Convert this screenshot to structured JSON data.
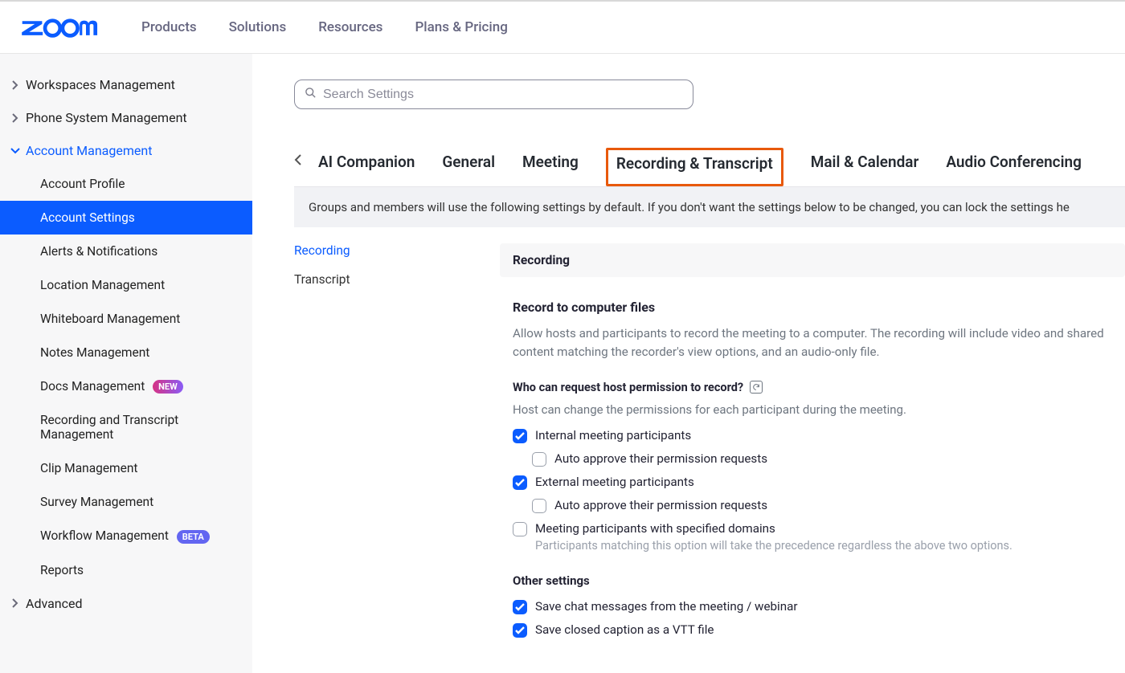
{
  "topnav": [
    "Products",
    "Solutions",
    "Resources",
    "Plans & Pricing"
  ],
  "search": {
    "placeholder": "Search Settings"
  },
  "sidebar": {
    "groups": [
      {
        "label": "Workspaces Management",
        "expanded": false
      },
      {
        "label": "Phone System Management",
        "expanded": false
      },
      {
        "label": "Account Management",
        "expanded": true
      },
      {
        "label": "Advanced",
        "expanded": false
      }
    ],
    "account_children": [
      {
        "label": "Account Profile"
      },
      {
        "label": "Account Settings",
        "active": true
      },
      {
        "label": "Alerts & Notifications"
      },
      {
        "label": "Location Management"
      },
      {
        "label": "Whiteboard Management"
      },
      {
        "label": "Notes Management"
      },
      {
        "label": "Docs Management",
        "badge": "NEW",
        "badgeClass": "new"
      },
      {
        "label": "Recording and Transcript Management"
      },
      {
        "label": "Clip Management"
      },
      {
        "label": "Survey Management"
      },
      {
        "label": "Workflow Management",
        "badge": "BETA",
        "badgeClass": "beta"
      },
      {
        "label": "Reports"
      }
    ]
  },
  "tabs": [
    "AI Companion",
    "General",
    "Meeting",
    "Recording & Transcript",
    "Mail & Calendar",
    "Audio Conferencing"
  ],
  "tabs_highlight_index": 3,
  "banner": "Groups and members will use the following settings by default. If you don't want the settings below to be changed, you can lock the settings he",
  "subnav": [
    {
      "label": "Recording",
      "active": true
    },
    {
      "label": "Transcript"
    }
  ],
  "section": {
    "header": "Recording",
    "title": "Record to computer files",
    "desc": "Allow hosts and participants to record the meeting to a computer. The recording will include video and shared content matching the recorder's view options, and an audio-only file.",
    "sub_q": "Who can request host permission to record?",
    "sub_desc": "Host can change the permissions for each participant during the meeting.",
    "opts": [
      {
        "label": "Internal meeting participants",
        "checked": true
      },
      {
        "label": "Auto approve their permission requests",
        "checked": false,
        "indent": true
      },
      {
        "label": "External meeting participants",
        "checked": true
      },
      {
        "label": "Auto approve their permission requests",
        "checked": false,
        "indent": true
      },
      {
        "label": "Meeting participants with specified domains",
        "checked": false,
        "note": "Participants matching this option will take the precedence regardless the above two options."
      }
    ],
    "other_head": "Other settings",
    "other_opts": [
      {
        "label": "Save chat messages from the meeting / webinar",
        "checked": true
      },
      {
        "label": "Save closed caption as a VTT file",
        "checked": true
      }
    ]
  }
}
